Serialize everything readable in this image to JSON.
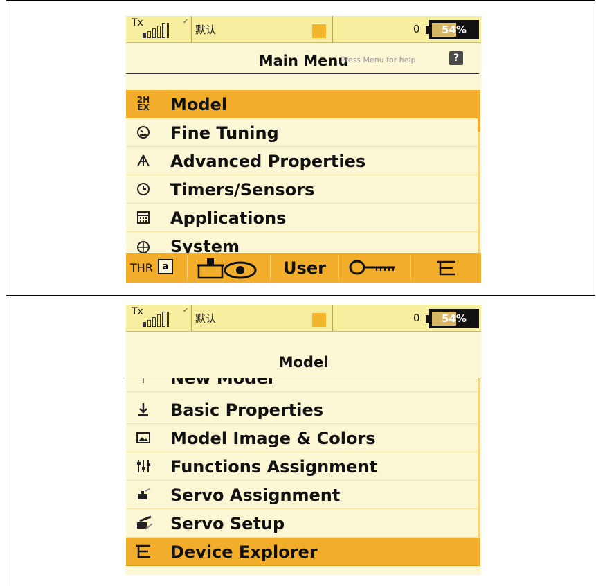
{
  "screen1": {
    "status": {
      "tx_label": "Tx",
      "profile": "默认",
      "counter": "0",
      "battery": "54%"
    },
    "title": "Main Menu",
    "help_text": "Press Menu for help",
    "help_icon": "?",
    "menu_items": [
      {
        "icon": "model-24ex-icon",
        "label": "Model",
        "selected": true
      },
      {
        "icon": "gauge-icon",
        "label": "Fine Tuning",
        "selected": false
      },
      {
        "icon": "triangle-nodes-icon",
        "label": "Advanced Properties",
        "selected": false
      },
      {
        "icon": "clock-icon",
        "label": "Timers/Sensors",
        "selected": false
      },
      {
        "icon": "grid-calculator-icon",
        "label": "Applications",
        "selected": false
      },
      {
        "icon": "globe-icon",
        "label": "System",
        "selected": false
      }
    ],
    "function_bar": {
      "thr_label": "THR",
      "lock_glyph": "a",
      "user_label": "User"
    }
  },
  "screen2": {
    "status": {
      "tx_label": "Tx",
      "profile": "默认",
      "counter": "0",
      "battery": "54%"
    },
    "title": "Model",
    "menu_items": [
      {
        "icon": "new-model-icon",
        "label": "New Model",
        "selected": false
      },
      {
        "icon": "download-arrow-icon",
        "label": "Basic Properties",
        "selected": false
      },
      {
        "icon": "image-icon",
        "label": "Model Image & Colors",
        "selected": false
      },
      {
        "icon": "sliders-icon",
        "label": "Functions Assignment",
        "selected": false
      },
      {
        "icon": "servo-icon",
        "label": "Servo Assignment",
        "selected": false
      },
      {
        "icon": "servo-arm-icon",
        "label": "Servo Setup",
        "selected": false
      },
      {
        "icon": "tree-icon",
        "label": "Device Explorer",
        "selected": true
      }
    ]
  },
  "colors": {
    "screen_bg": "#fbf6d4",
    "status_bg": "#f7eea0",
    "selected_bg": "#f2ad2b",
    "battery_fill": "#d8b867"
  }
}
